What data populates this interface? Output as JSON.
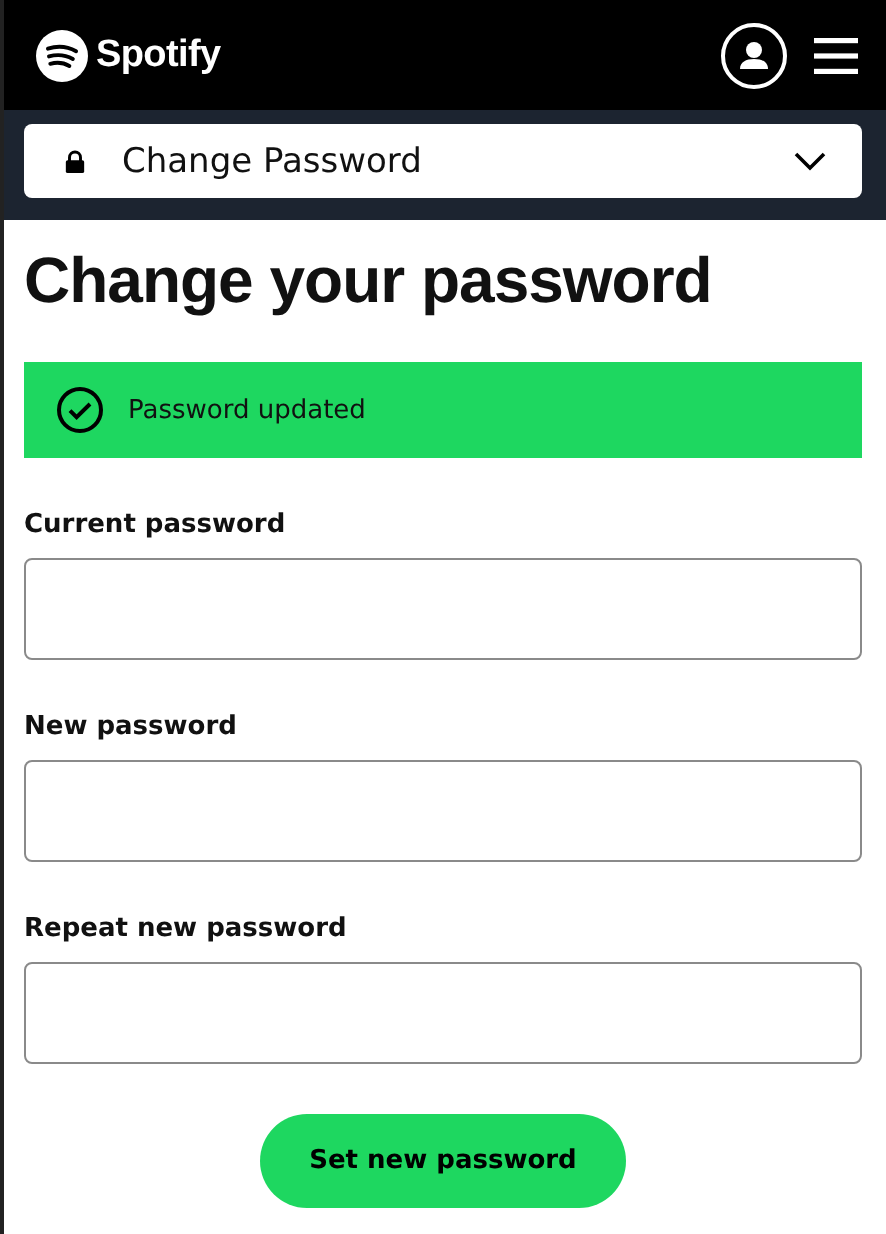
{
  "header": {
    "brand": "Spotify"
  },
  "nav_dropdown": {
    "label": "Change Password",
    "expanded": false
  },
  "title": "Change your password",
  "alert": {
    "kind": "success",
    "message": "Password updated"
  },
  "fields": [
    {
      "label": "Current password"
    },
    {
      "label": "New password"
    },
    {
      "label": "Repeat new password"
    }
  ],
  "submit_button": "Set new password"
}
